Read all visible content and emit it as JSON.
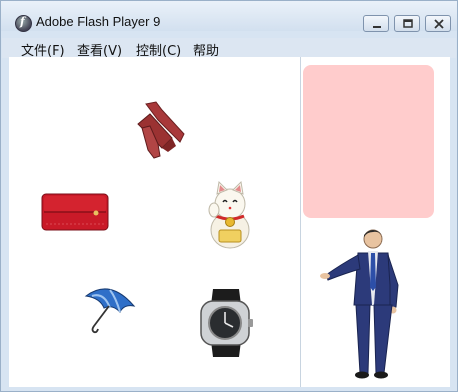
{
  "window": {
    "title": "Adobe Flash Player 9"
  },
  "menu": [
    "文件(F)",
    "查看(V)",
    "控制(C)",
    "帮助"
  ],
  "icons": [
    "flash-player-icon",
    "minimize-icon",
    "maximize-icon",
    "close-icon"
  ],
  "colors": {
    "target_box": "#ffcccc",
    "stage": "#ffffff",
    "chrome": "#d7e4f2"
  },
  "stage": {
    "items": [
      "necktie",
      "red-wallet",
      "lucky-cat",
      "umbrella",
      "wristwatch"
    ],
    "figure": "businessman"
  }
}
